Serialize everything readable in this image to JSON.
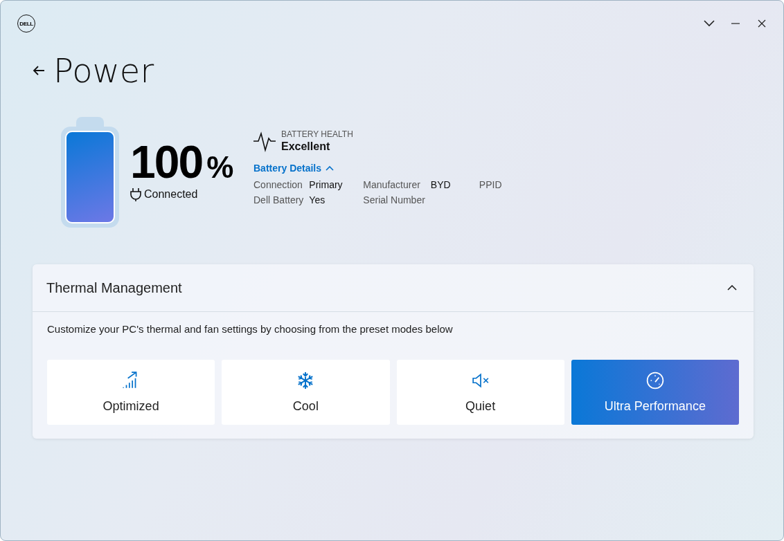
{
  "window": {
    "logo": "DELL"
  },
  "page": {
    "title": "Power"
  },
  "battery": {
    "level": 1,
    "percent": "100",
    "unit": "%",
    "status": "Connected",
    "health_label": "BATTERY HEALTH",
    "health_value": "Excellent",
    "details_link": "Battery Details",
    "details_expanded": true,
    "details": [
      [
        {
          "label": "Connection",
          "value": "Primary"
        },
        {
          "label": "Manufacturer",
          "value": "BYD"
        },
        {
          "label": "PPID"
        }
      ],
      [
        {
          "label": "Dell Battery",
          "value": "Yes"
        },
        {
          "label": "Serial Number"
        }
      ]
    ]
  },
  "thermal": {
    "title": "Thermal Management",
    "expanded": true,
    "description": "Customize your PC's thermal and fan settings by choosing from the preset modes below",
    "modes": [
      {
        "kind": "optimized",
        "label": "Optimized",
        "selected": false
      },
      {
        "kind": "cool",
        "label": "Cool",
        "selected": false
      },
      {
        "kind": "quiet",
        "label": "Quiet",
        "selected": false
      },
      {
        "kind": "performance",
        "label": "Ultra Performance",
        "selected": true
      }
    ]
  }
}
